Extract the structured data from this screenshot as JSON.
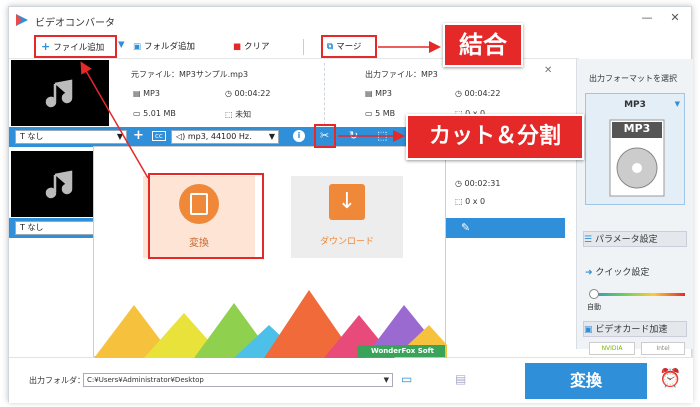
{
  "app": {
    "title": "ビデオコンバータ"
  },
  "toolbar": {
    "add_file": "ファイル追加",
    "add_folder": "フォルダ追加",
    "clear": "クリア",
    "merge": "マージ"
  },
  "file1": {
    "source_label": "元ファイル：",
    "source_name": "MP3サンプル.mp3",
    "format": "MP3",
    "duration": "00:04:22",
    "size": "5.01 MB",
    "resolution": "未知",
    "output_label": "出力ファイル：",
    "output_name": "MP3",
    "out_format": "MP3",
    "out_duration": "00:04:22",
    "out_size": "5 MB",
    "out_resolution": "0 x 0"
  },
  "file2": {
    "out_duration": "00:02:31",
    "out_resolution": "0 x 0"
  },
  "bar": {
    "subtitle": "なし",
    "audio": "mp3, 44100 Hz.",
    "info_icon": "i"
  },
  "bar2": {
    "subtitle": "なし"
  },
  "overlay": {
    "convert_label": "変換",
    "download_label": "ダウンロード",
    "brand": "WonderFox Soft"
  },
  "right": {
    "heading": "出力フォーマットを選択",
    "format": "MP3",
    "format_icon_text": "MP3",
    "param": "パラメータ設定",
    "quick": "クイック設定",
    "auto": "自動",
    "gpu": "ビデオカード加速",
    "nvidia": "NVIDIA",
    "intel": "Intel"
  },
  "bottom": {
    "folder_label": "出力フォルダ：",
    "path": "C:¥Users¥Administrator¥Desktop",
    "convert": "変換"
  },
  "annotations": {
    "merge": "結合",
    "cut": "カット＆分割"
  },
  "colors": {
    "accent": "#2f8fd8",
    "red": "#e52929",
    "orange": "#f0883a"
  }
}
